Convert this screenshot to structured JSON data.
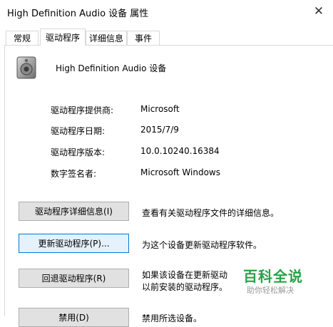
{
  "window": {
    "title": "High Definition Audio 设备 属性",
    "close_glyph": "✕"
  },
  "tabs": [
    {
      "label": "常规"
    },
    {
      "label": "驱动程序"
    },
    {
      "label": "详细信息"
    },
    {
      "label": "事件"
    }
  ],
  "device": {
    "name": "High Definition Audio 设备",
    "icon": "speaker-icon"
  },
  "info": {
    "provider_label": "驱动程序提供商:",
    "provider_value": "Microsoft",
    "date_label": "驱动程序日期:",
    "date_value": "2015/7/9",
    "version_label": "驱动程序版本:",
    "version_value": "10.0.10240.16384",
    "signer_label": "数字签名者:",
    "signer_value": "Microsoft Windows"
  },
  "actions": {
    "details_button": "驱动程序详细信息(I)",
    "details_desc": "查看有关驱动程序文件的详细信息。",
    "update_button": "更新驱动程序(P)...",
    "update_desc": "为这个设备更新驱动程序软件。",
    "rollback_button": "回退驱动程序(R)",
    "rollback_desc_1": "如果该设备在更新驱动",
    "rollback_desc_2": "以前安装的驱动程序。",
    "disable_button": "禁用(D)",
    "disable_desc": "禁用所选设备。"
  },
  "watermark": {
    "main": "百科全说",
    "sub": "助你轻松解决"
  },
  "colors": {
    "focus_border": "#0078d7",
    "button_bg": "#e1e1e1",
    "watermark": "#27a348"
  }
}
